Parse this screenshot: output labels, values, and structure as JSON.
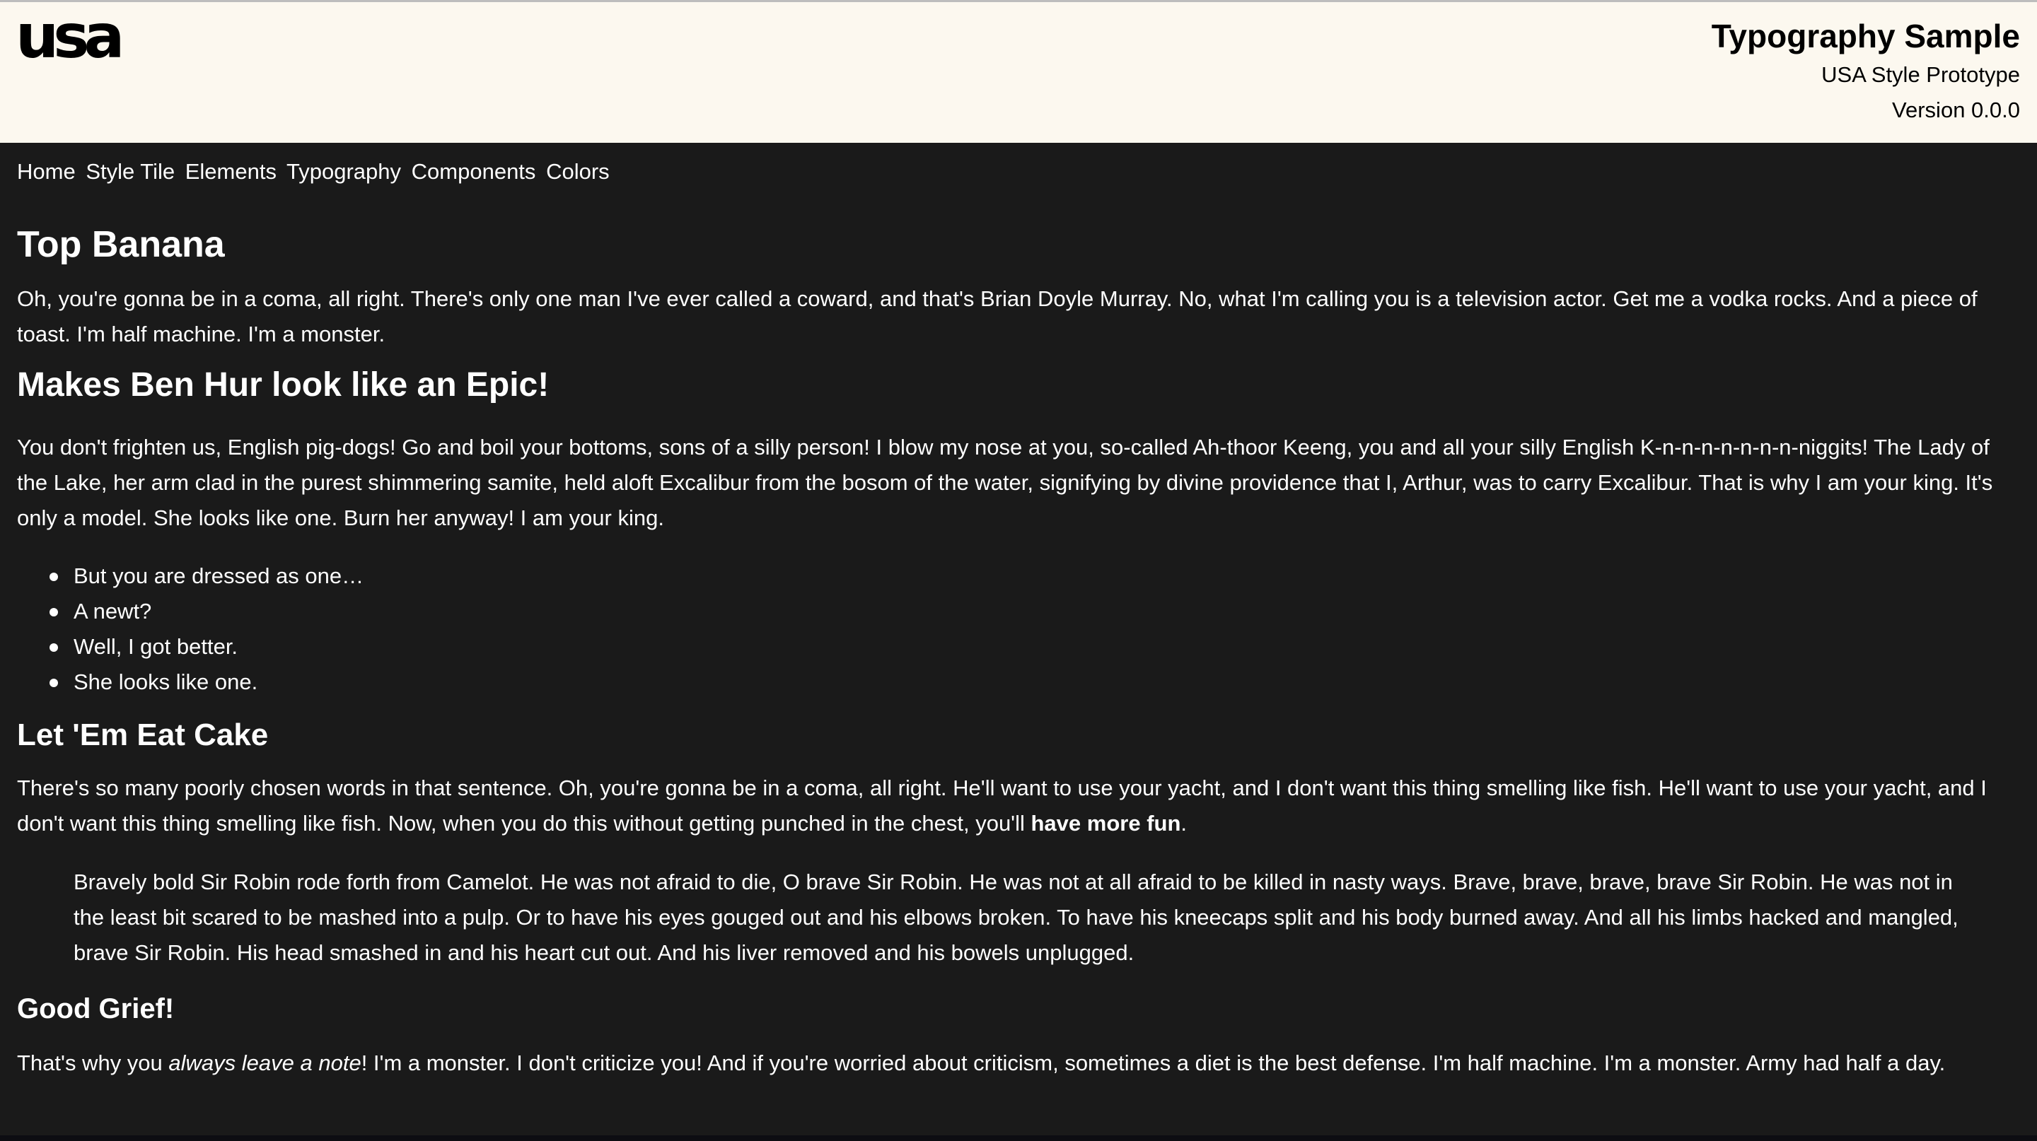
{
  "header": {
    "logo_text": "usa",
    "title": "Typography Sample",
    "subtitle": "USA Style Prototype",
    "version": "Version 0.0.0"
  },
  "nav": {
    "items": [
      {
        "label": "Home"
      },
      {
        "label": "Style Tile"
      },
      {
        "label": "Elements"
      },
      {
        "label": "Typography"
      },
      {
        "label": "Components"
      },
      {
        "label": "Colors"
      }
    ]
  },
  "sections": {
    "top_banana": {
      "heading": "Top Banana",
      "paragraph": "Oh, you're gonna be in a coma, all right. There's only one man I've ever called a coward, and that's Brian Doyle Murray. No, what I'm calling you is a television actor. Get me a vodka rocks. And a piece of toast. I'm half machine. I'm a monster."
    },
    "ben_hur": {
      "heading": "Makes Ben Hur look like an Epic!",
      "paragraph": "You don't frighten us, English pig-dogs! Go and boil your bottoms, sons of a silly person! I blow my nose at you, so-called Ah-thoor Keeng, you and all your silly English K-n-n-n-n-n-n-n-niggits! The Lady of the Lake, her arm clad in the purest shimmering samite, held aloft Excalibur from the bosom of the water, signifying by divine providence that I, Arthur, was to carry Excalibur. That is why I am your king. It's only a model. She looks like one. Burn her anyway! I am your king.",
      "list": [
        "But you are dressed as one…",
        "A newt?",
        "Well, I got better.",
        "She looks like one."
      ]
    },
    "cake": {
      "heading": "Let 'Em Eat Cake",
      "paragraph_before": "There's so many poorly chosen words in that sentence. Oh, you're gonna be in a coma, all right. He'll want to use your yacht, and I don't want this thing smelling like fish. He'll want to use your yacht, and I don't want this thing smelling like fish. Now, when you do this without getting punched in the chest, you'll ",
      "paragraph_bold": "have more fun",
      "paragraph_after": ".",
      "quote": "Bravely bold Sir Robin rode forth from Camelot. He was not afraid to die, O brave Sir Robin. He was not at all afraid to be killed in nasty ways. Brave, brave, brave, brave Sir Robin. He was not in the least bit scared to be mashed into a pulp. Or to have his eyes gouged out and his elbows broken. To have his kneecaps split and his body burned away. And all his limbs hacked and mangled, brave Sir Robin. His head smashed in and his heart cut out. And his liver removed and his bowels unplugged."
    },
    "grief": {
      "heading": "Good Grief!",
      "paragraph_before": "That's why you ",
      "paragraph_italic": "always leave a note",
      "paragraph_after": "! I'm a monster. I don't criticize you! And if you're worried about criticism, sometimes a diet is the best defense. I'm half machine. I'm a monster. Army had half a day."
    }
  },
  "colors": {
    "header_bg": "#fcf8ef",
    "page_bg": "#1a1a1a",
    "text": "#ffffff",
    "header_text": "#000000"
  }
}
